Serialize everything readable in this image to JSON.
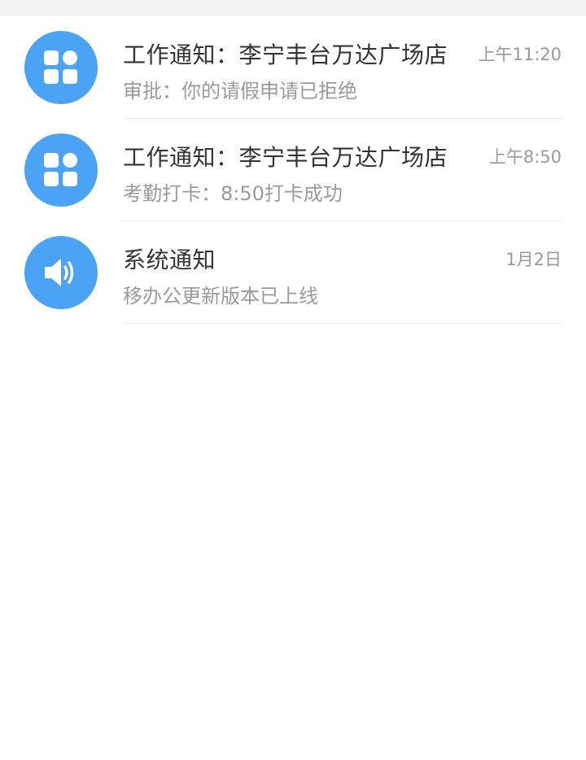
{
  "colors": {
    "accent": "#4ba3f5",
    "top_strip": "#f4f4f4",
    "title_text": "#333333",
    "meta_text": "#9a9a9a",
    "divider": "#ececec"
  },
  "messages": [
    {
      "icon": "apps-grid-icon",
      "title": "工作通知：李宁丰台万达广场店",
      "time": "上午11:20",
      "subtitle": "审批：你的请假申请已拒绝"
    },
    {
      "icon": "apps-grid-icon",
      "title": "工作通知：李宁丰台万达广场店",
      "time": "上午8:50",
      "subtitle": "考勤打卡：8:50打卡成功"
    },
    {
      "icon": "speaker-icon",
      "title": "系统通知",
      "time": "1月2日",
      "subtitle": "移办公更新版本已上线"
    }
  ]
}
